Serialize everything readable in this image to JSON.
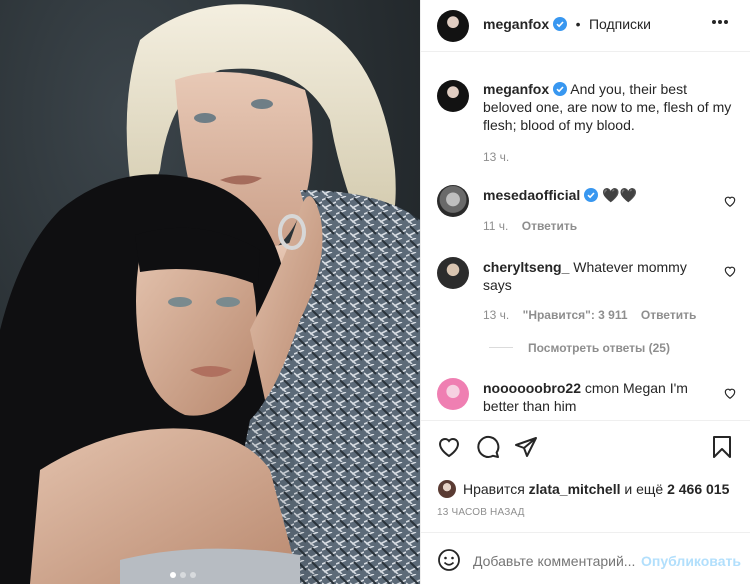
{
  "post": {
    "author": "meganfox",
    "header_separator": "•",
    "follow_label": "Подписки",
    "more_icon": "more-dots-icon",
    "caption": {
      "username": "meganfox",
      "text": "And you, their best beloved one, are now to me, flesh of my flesh; blood of my blood.",
      "time": "13 ч."
    },
    "comments": [
      {
        "username": "mesedaofficial",
        "verified": true,
        "text": "🖤🖤",
        "time": "11 ч.",
        "reply_label": "Ответить"
      },
      {
        "username": "cheryltseng_",
        "verified": false,
        "text": "Whatever mommy says",
        "time": "13 ч.",
        "likes_label": "\"Нравится\": 3 911",
        "reply_label": "Ответить",
        "view_replies": "Посмотреть ответы (25)"
      },
      {
        "username": "noooooobro22",
        "verified": false,
        "text": "cmon Megan I'm better than him"
      }
    ],
    "likes": {
      "prefix": "Нравится",
      "user": "zlata_mitchell",
      "middle": "и ещё",
      "count": "2 466 015"
    },
    "timestamp": "13 ЧАСОВ НАЗАД",
    "comment_input": {
      "placeholder": "Добавьте комментарий...",
      "submit_label": "Опубликовать"
    },
    "carousel": {
      "slides": 3,
      "active": 1
    },
    "colors": {
      "verified": "#3897f0",
      "muted": "#8e8e8e",
      "submit_disabled": "#b2dffc"
    }
  }
}
